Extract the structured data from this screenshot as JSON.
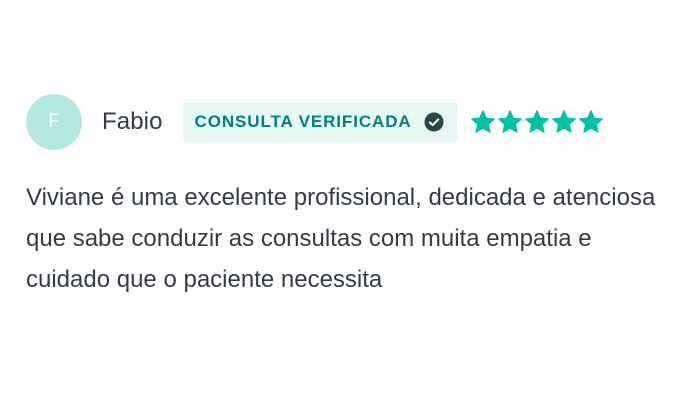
{
  "review": {
    "avatar_initial": "F",
    "author": "Fabio",
    "badge_label": "CONSULTA VERIFICADA",
    "badge_icon": "check-circle-icon",
    "rating": 5,
    "rating_max": 5,
    "star_color": "#00c3a5",
    "text": "Viviane é uma excelente profissional, dedicada e atenciosa que sabe conduzir as consultas com muita empatia e cuidado que o paciente necessita"
  },
  "colors": {
    "avatar_bg": "#b3e9e1",
    "badge_bg": "#e6f7f4",
    "badge_text": "#00817a",
    "body_text": "#333d46"
  }
}
